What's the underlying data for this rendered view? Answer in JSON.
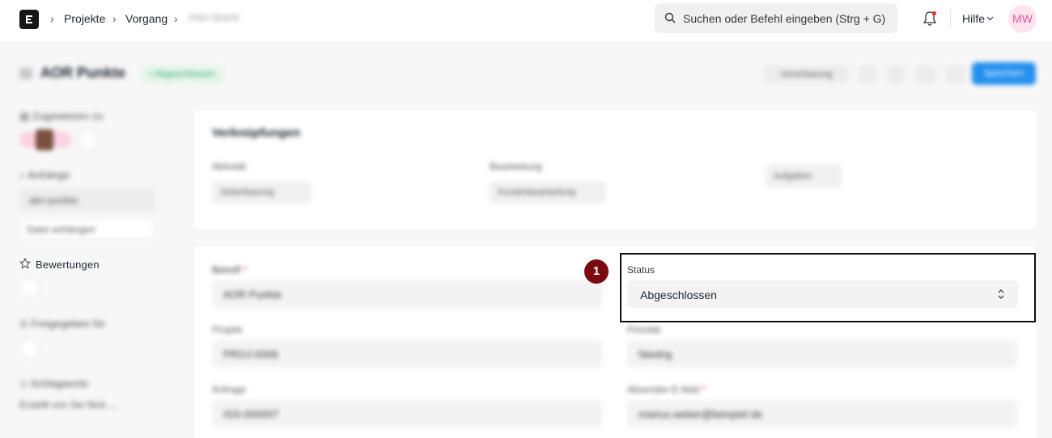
{
  "navbar": {
    "breadcrumbs": [
      "Projekte",
      "Vorgang",
      "VNG-00426"
    ],
    "search_placeholder": "Suchen oder Befehl eingeben (Strg + G)",
    "help_label": "Hilfe",
    "avatar_initials": "MW"
  },
  "header": {
    "title": "AOR Punkte",
    "status_badge": "• Abgeschlossen",
    "secondary_button": "Vorschauung",
    "primary_button": "Speichern"
  },
  "sidebar": {
    "assigned_label": "Zugewiesen zu",
    "attachments_label": "Anhänge",
    "attachment_file": "abn-punkte",
    "attach_button": "Datei anhängen",
    "ratings_label": "Bewertungen",
    "shared_label": "Freigegeben für",
    "tags_label": "Schlagworte",
    "meta_text": "Erstellt von Sie Nick ..."
  },
  "links": {
    "title": "Verknüpfungen",
    "col1_label": "Aktivität",
    "col1_chip": "Zeiterfassung",
    "col2_label": "Bearbeitung",
    "col2_chip": "Kundenbearbeitung",
    "col3_chip": "Aufgaben"
  },
  "form": {
    "subject_label": "Betreff",
    "subject_value": "AOR Punkte",
    "required_mark": "*",
    "project_label": "Projekt",
    "project_value": "PROJ-0006",
    "request_label": "Anfrage",
    "request_value": "ISS-000007",
    "status_label": "Status",
    "status_value": "Abgeschlossen",
    "priority_label": "Priorität",
    "priority_value": "Niedrig",
    "contact_label": "Absender-E-Mail",
    "contact_value": "marius.weber@beispiel.de"
  },
  "annotation_marker": "1",
  "colors": {
    "primary": "#2490ef",
    "marker": "#7a0a10",
    "success": "#30a66d",
    "avatar_bg": "#fde4ef"
  }
}
